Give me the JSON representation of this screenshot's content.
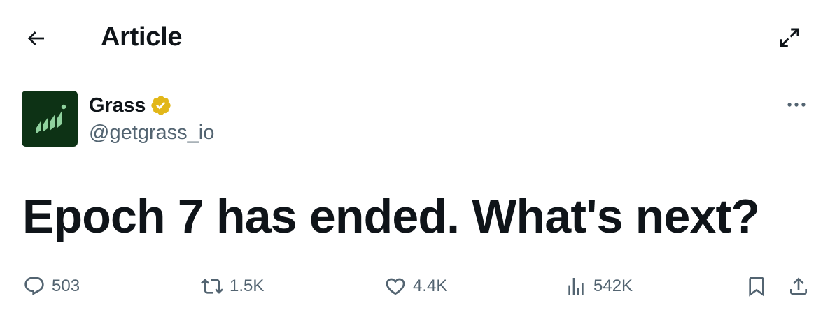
{
  "header": {
    "title": "Article",
    "back_icon": "arrow-left-icon",
    "expand_icon": "expand-icon"
  },
  "author": {
    "name": "Grass",
    "handle": "@getgrass_io",
    "verified": true,
    "verified_color": "#e2b719",
    "avatar_bg": "#0d3215",
    "avatar_fg": "#8fd19e"
  },
  "article": {
    "headline": "Epoch 7 has ended. What's next?"
  },
  "actions": {
    "replies": "503",
    "reposts": "1.5K",
    "likes": "4.4K",
    "views": "542K"
  },
  "colors": {
    "text_primary": "#0f1419",
    "text_secondary": "#536471"
  }
}
